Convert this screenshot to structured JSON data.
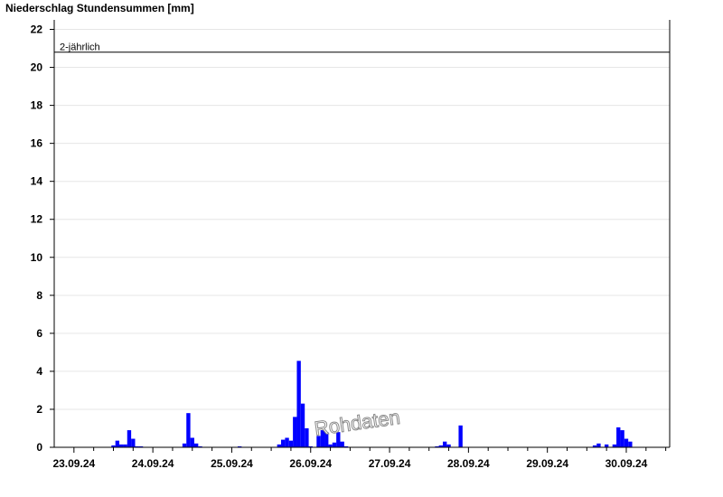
{
  "chart_data": {
    "type": "bar",
    "title": "Niederschlag Stundensummen [mm]",
    "xlabel": "",
    "ylabel": "",
    "ylim": [
      0,
      22.5
    ],
    "yticks": [
      0,
      2,
      4,
      6,
      8,
      10,
      12,
      14,
      16,
      18,
      20,
      22
    ],
    "x_tick_labels": [
      "23.09.24",
      "24.09.24",
      "25.09.24",
      "26.09.24",
      "27.09.24",
      "28.09.24",
      "29.09.24",
      "30.09.24"
    ],
    "x_range_days": [
      -0.25,
      7.55
    ],
    "grid": "horizontal",
    "bar_color": "#0000ff",
    "reference_line": {
      "label": "2-jährlich",
      "value": 20.8
    },
    "watermark": "Rohdaten",
    "series": [
      {
        "x_day_offset": [
          0.5,
          0.55,
          0.6,
          0.65,
          0.7,
          0.75,
          0.8,
          0.85,
          1.4,
          1.45,
          1.5,
          1.55,
          1.6,
          2.1,
          2.6,
          2.65,
          2.7,
          2.75,
          2.8,
          2.85,
          2.9,
          2.95,
          3.0,
          3.1,
          3.15,
          3.2,
          3.25,
          3.3,
          3.35,
          3.4,
          3.45,
          4.6,
          4.65,
          4.7,
          4.75,
          4.9,
          6.6,
          6.65,
          6.75,
          6.85,
          6.9,
          6.95,
          7.0,
          7.05
        ],
        "values": [
          0.1,
          0.35,
          0.15,
          0.15,
          0.9,
          0.45,
          0.05,
          0.05,
          0.2,
          1.8,
          0.5,
          0.2,
          0.05,
          0.05,
          0.15,
          0.4,
          0.5,
          0.35,
          1.6,
          4.55,
          2.3,
          1.0,
          0.05,
          0.6,
          0.9,
          0.8,
          0.15,
          0.25,
          0.8,
          0.3,
          0.05,
          0.05,
          0.1,
          0.3,
          0.15,
          1.15,
          0.1,
          0.2,
          0.15,
          0.15,
          1.05,
          0.9,
          0.45,
          0.3
        ]
      }
    ]
  }
}
